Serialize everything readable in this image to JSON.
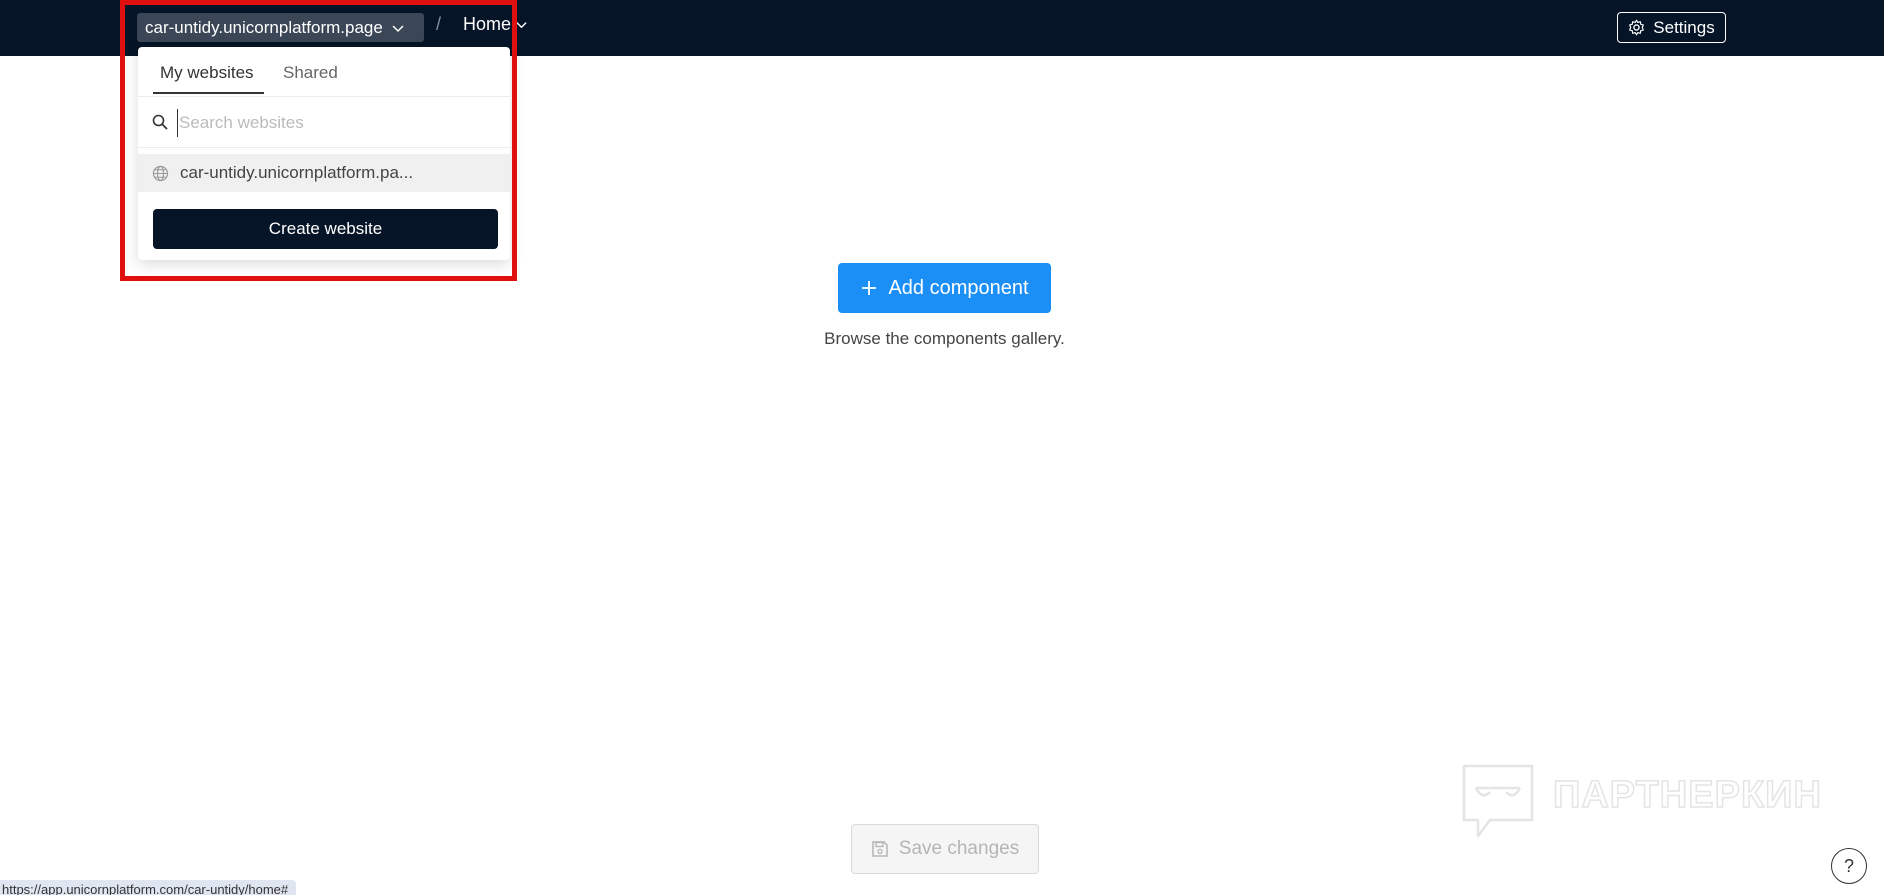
{
  "topbar": {
    "site_name": "car-untidy.unicornplatform.page",
    "separator": "/",
    "page_name": "Home",
    "settings_label": "Settings"
  },
  "dropdown": {
    "tabs": [
      {
        "label": "My websites",
        "active": true
      },
      {
        "label": "Shared",
        "active": false
      }
    ],
    "search_placeholder": "Search websites",
    "items": [
      {
        "label": "car-untidy.unicornplatform.pa..."
      }
    ],
    "create_label": "Create website"
  },
  "main": {
    "add_component_label": "Add component",
    "browse_text": "Browse the components gallery."
  },
  "footer": {
    "save_label": "Save changes",
    "help_label": "?",
    "status_url": "https://app.unicornplatform.com/car-untidy/home#"
  },
  "watermark": {
    "text": "ПАРТНЕРКИН"
  },
  "colors": {
    "topbar_bg": "#061427",
    "accent_blue": "#1b8ff5",
    "highlight_red": "#e01010"
  }
}
